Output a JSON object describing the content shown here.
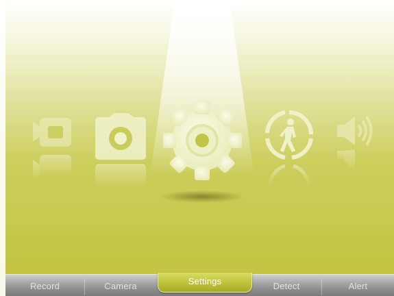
{
  "colors": {
    "background_top": "#ffffff",
    "background_bottom": "#c2c23c",
    "icon_fill": "#f2f4d0",
    "accent": "#bdc13a"
  },
  "carousel": {
    "items": [
      {
        "id": "record",
        "icon": "video-camera-icon"
      },
      {
        "id": "camera",
        "icon": "camera-icon"
      },
      {
        "id": "settings",
        "icon": "gear-icon",
        "selected": true
      },
      {
        "id": "detect",
        "icon": "walking-person-icon"
      },
      {
        "id": "alert",
        "icon": "speaker-icon"
      }
    ]
  },
  "tabs": [
    {
      "label": "Record"
    },
    {
      "label": "Camera"
    },
    {
      "label": "Settings",
      "active": true
    },
    {
      "label": "Detect"
    },
    {
      "label": "Alert"
    }
  ]
}
